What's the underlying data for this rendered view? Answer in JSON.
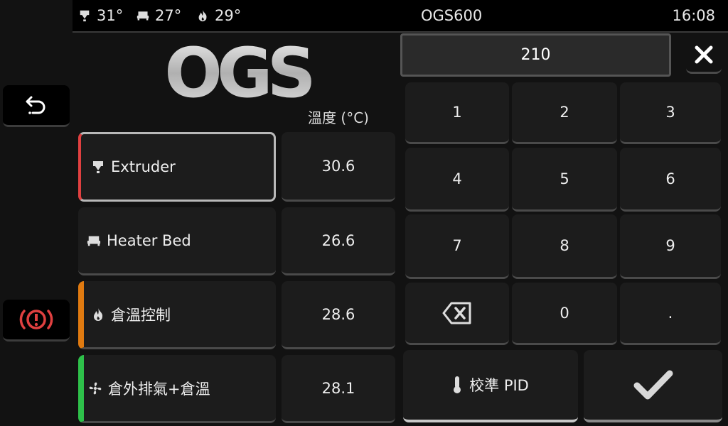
{
  "topbar": {
    "extruder_temp": "31°",
    "bed_temp": "27°",
    "chamber_temp": "29°",
    "title": "OGS600",
    "clock": "16:08"
  },
  "logo_text": "OGS",
  "table": {
    "header": "溫度 (°C)",
    "rows": [
      {
        "name": "Extruder",
        "value": "30.6",
        "accent": "#e04040"
      },
      {
        "name": "Heater Bed",
        "value": "26.6",
        "accent": ""
      },
      {
        "name": "倉溫控制",
        "value": "28.6",
        "accent": "#e07a10"
      },
      {
        "name": "倉外排氣+倉溫",
        "value": "28.1",
        "accent": "#2ec04a"
      }
    ]
  },
  "keypad": {
    "entry_value": "210",
    "keys": [
      "1",
      "2",
      "3",
      "4",
      "5",
      "6",
      "7",
      "8",
      "9",
      "",
      "0",
      "."
    ],
    "pid_label": "校準 PID"
  },
  "colors": {
    "emergency": "#e04040",
    "panel": "#1c1c1c"
  },
  "icons": [
    "back-icon",
    "emergency-stop-icon",
    "extruder-icon",
    "bed-icon",
    "flame-icon",
    "fan-icon",
    "close-icon",
    "backspace-icon",
    "thermometer-icon",
    "checkmark-icon"
  ]
}
